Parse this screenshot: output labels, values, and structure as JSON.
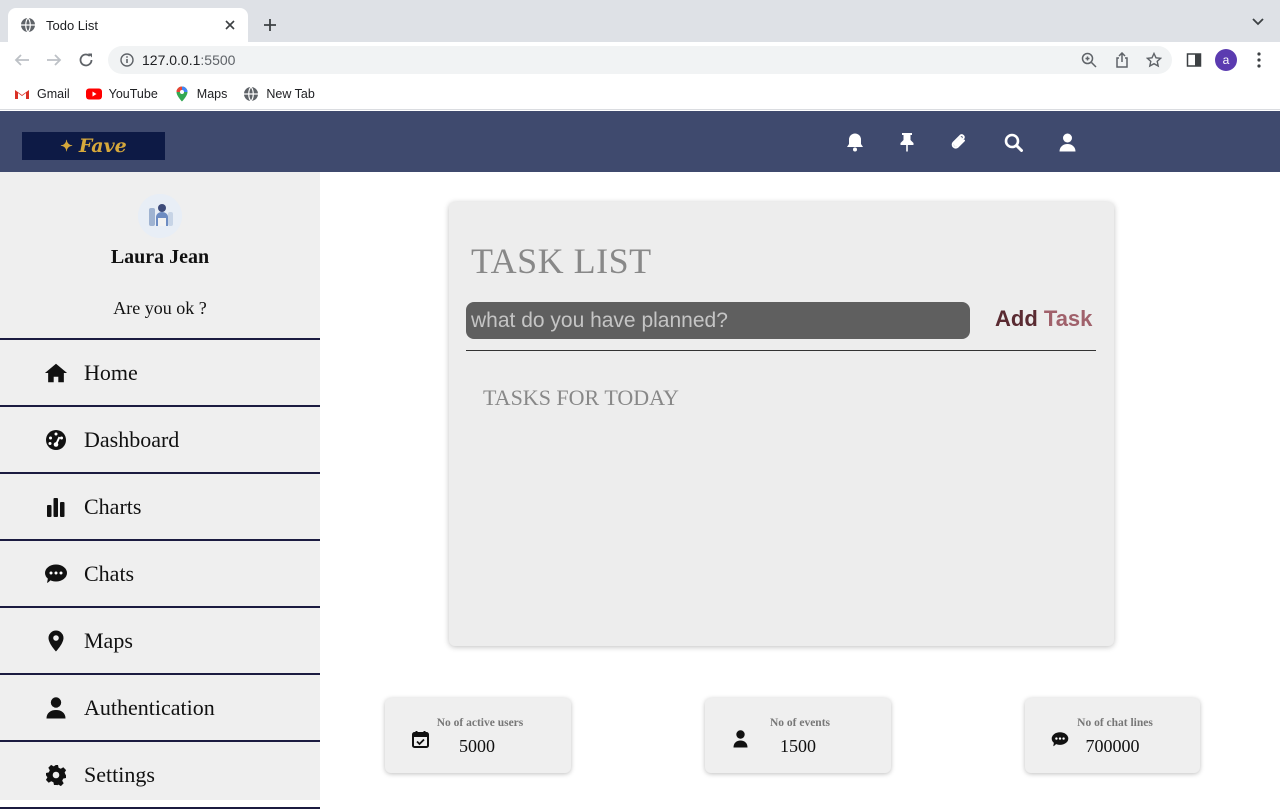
{
  "browser": {
    "tab_title": "Todo List",
    "url_host": "127.0.0.1",
    "url_port": ":5500",
    "profile_initial": "a",
    "bookmarks": [
      "Gmail",
      "YouTube",
      "Maps",
      "New Tab"
    ]
  },
  "header": {
    "logo_text": "Fave",
    "icons": [
      "bell-icon",
      "pin-icon",
      "paperclip-icon",
      "search-icon",
      "user-icon"
    ]
  },
  "sidebar": {
    "user_name": "Laura Jean",
    "user_status": "Are you ok ?",
    "items": [
      {
        "label": "Home",
        "icon": "home-icon"
      },
      {
        "label": "Dashboard",
        "icon": "dashboard-icon"
      },
      {
        "label": "Charts",
        "icon": "chart-icon"
      },
      {
        "label": "Chats",
        "icon": "chat-icon"
      },
      {
        "label": "Maps",
        "icon": "map-pin-icon"
      },
      {
        "label": "Authentication",
        "icon": "user-icon"
      },
      {
        "label": "Settings",
        "icon": "gear-icon"
      }
    ]
  },
  "tasks": {
    "title": "TASK LIST",
    "input_placeholder": "what do you have planned?",
    "add_label_word1": "Add",
    "add_label_word2": "Task",
    "today_title": "TASKS FOR TODAY"
  },
  "stats": [
    {
      "label": "No of active users",
      "value": "5000",
      "icon": "calendar-check-icon"
    },
    {
      "label": "No of events",
      "value": "1500",
      "icon": "user-icon"
    },
    {
      "label": "No of chat lines",
      "value": "700000",
      "icon": "chat-icon"
    }
  ],
  "colors": {
    "header_bg": "#3f4a6e",
    "logo_bg": "#0d1a45",
    "sidebar_bg": "#efefef",
    "divider": "#1b1b40",
    "input_bg": "#5f5f5f",
    "add_dark": "#5a2b32",
    "add_light": "#a0616b"
  }
}
